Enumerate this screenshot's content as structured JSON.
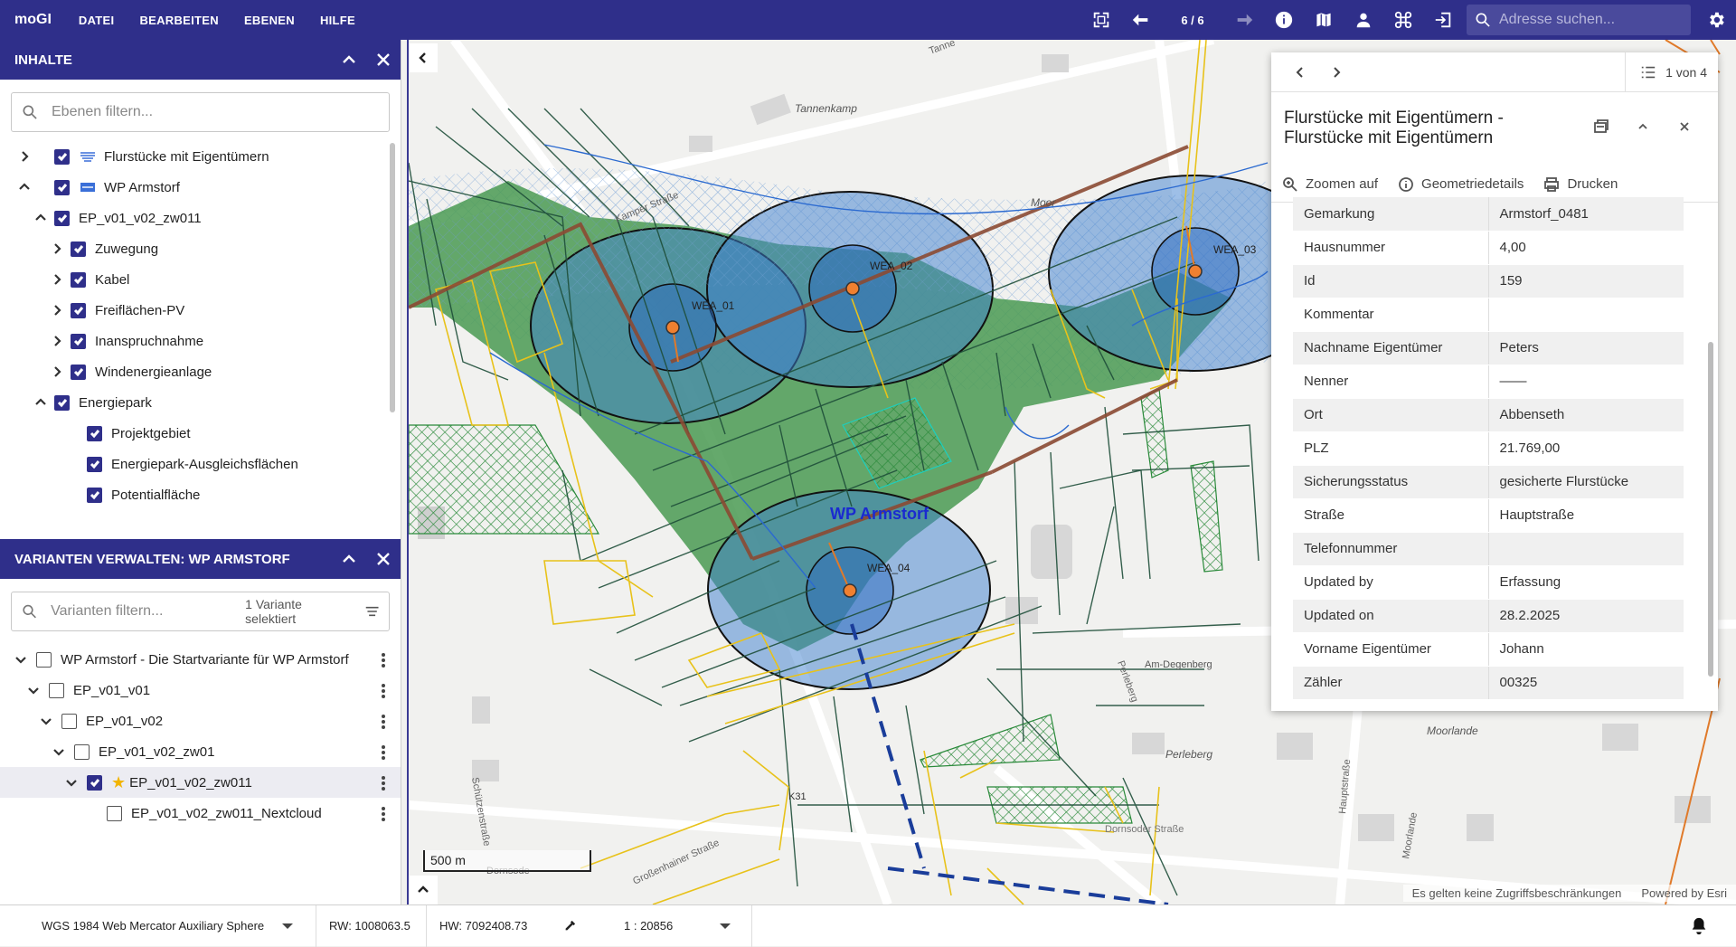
{
  "app": {
    "title": "moGI"
  },
  "menu": [
    "DATEI",
    "BEARBEITEN",
    "EBENEN",
    "HILFE"
  ],
  "toolbar": {
    "extent_count": "6 / 6",
    "search_placeholder": "Adresse suchen..."
  },
  "contents_panel": {
    "title": "INHALTE",
    "filter_placeholder": "Ebenen filtern...",
    "layers": [
      {
        "label": "Flurstücke mit Eigentümern",
        "expanded": false,
        "checked": true
      },
      {
        "label": "WP Armstorf",
        "expanded": true,
        "checked": true
      },
      {
        "label": "EP_v01_v02_zw011",
        "expanded": true,
        "checked": true
      },
      {
        "label": "Zuwegung",
        "expanded": false,
        "checked": true
      },
      {
        "label": "Kabel",
        "expanded": false,
        "checked": true
      },
      {
        "label": "Freiflächen-PV",
        "expanded": false,
        "checked": true
      },
      {
        "label": "Inanspruchnahme",
        "expanded": false,
        "checked": true
      },
      {
        "label": "Windenergieanlage",
        "expanded": false,
        "checked": true
      },
      {
        "label": "Energiepark",
        "expanded": true,
        "checked": true
      },
      {
        "label": "Projektgebiet",
        "checked": true
      },
      {
        "label": "Energiepark-Ausgleichsflächen",
        "checked": true
      },
      {
        "label": "Potentialfläche",
        "checked": true
      }
    ]
  },
  "variants_panel": {
    "title": "VARIANTEN VERWALTEN: WP ARMSTORF",
    "filter_placeholder": "Varianten filtern...",
    "selected_info": "1 Variante selektiert",
    "variants": [
      {
        "label": "WP Armstorf - Die Startvariante für WP Armstorf",
        "checked": false
      },
      {
        "label": "EP_v01_v01",
        "checked": false
      },
      {
        "label": "EP_v01_v02",
        "checked": false
      },
      {
        "label": "EP_v01_v02_zw01",
        "checked": false
      },
      {
        "label": "EP_v01_v02_zw011",
        "checked": true,
        "starred": true
      },
      {
        "label": "EP_v01_v02_zw011_Nextcloud",
        "checked": false
      }
    ]
  },
  "map": {
    "labels": {
      "wp": "WP Armstorf",
      "wea01": "WEA_01",
      "wea02": "WEA_02",
      "wea03": "WEA_03",
      "wea04": "WEA_04",
      "tannenkamp": "Tannenkamp",
      "moor": "Moor",
      "kamper": "Kamper Straße",
      "amdegenberg": "Am-Degenberg",
      "perleberg": "Perleberg",
      "perleberg_road": "Perleberg",
      "moorlande": "Moorlande",
      "hauptstrasse": "Hauptstraße",
      "moorlande_road": "Moorlande",
      "k31": "K31",
      "dornsode": "Dornsode",
      "schuetzenstrasse": "Schützenstraße",
      "grossenhainer": "Großenhainer Straße",
      "tanne": "Tanne",
      "dornsoder": "Dornsoder Straße"
    },
    "scale_label": "500 m",
    "attribution": "Es gelten keine Zugriffsbeschränkungen",
    "powered_by": "Powered by Esri"
  },
  "popup": {
    "pager": "1 von 4",
    "title": "Flurstücke mit Eigentümern - Flurstücke mit Eigentümern",
    "actions": {
      "zoom": "Zoomen auf",
      "geometry": "Geometriedetails",
      "print": "Drucken"
    },
    "attributes": [
      {
        "key": "Gemarkung",
        "value": "Armstorf_0481"
      },
      {
        "key": "Hausnummer",
        "value": "4,00"
      },
      {
        "key": "Id",
        "value": "159"
      },
      {
        "key": "Kommentar",
        "value": ""
      },
      {
        "key": "Nachname Eigentümer",
        "value": "Peters"
      },
      {
        "key": "Nenner",
        "value": "——"
      },
      {
        "key": "Ort",
        "value": "Abbenseth"
      },
      {
        "key": "PLZ",
        "value": "21.769,00"
      },
      {
        "key": "Sicherungsstatus",
        "value": "gesicherte Flurstücke"
      },
      {
        "key": "Straße",
        "value": "Hauptstraße"
      },
      {
        "key": "Telefonnummer",
        "value": ""
      },
      {
        "key": "Updated by",
        "value": "Erfassung"
      },
      {
        "key": "Updated on",
        "value": "28.2.2025"
      },
      {
        "key": "Vorname Eigentümer",
        "value": "Johann"
      },
      {
        "key": "Zähler",
        "value": "00325"
      }
    ]
  },
  "statusbar": {
    "crs": "WGS 1984 Web Mercator Auxiliary Sphere",
    "rw": "RW: 1008063.5",
    "hw": "HW: 7092408.73",
    "scale": "1 : 20856"
  }
}
